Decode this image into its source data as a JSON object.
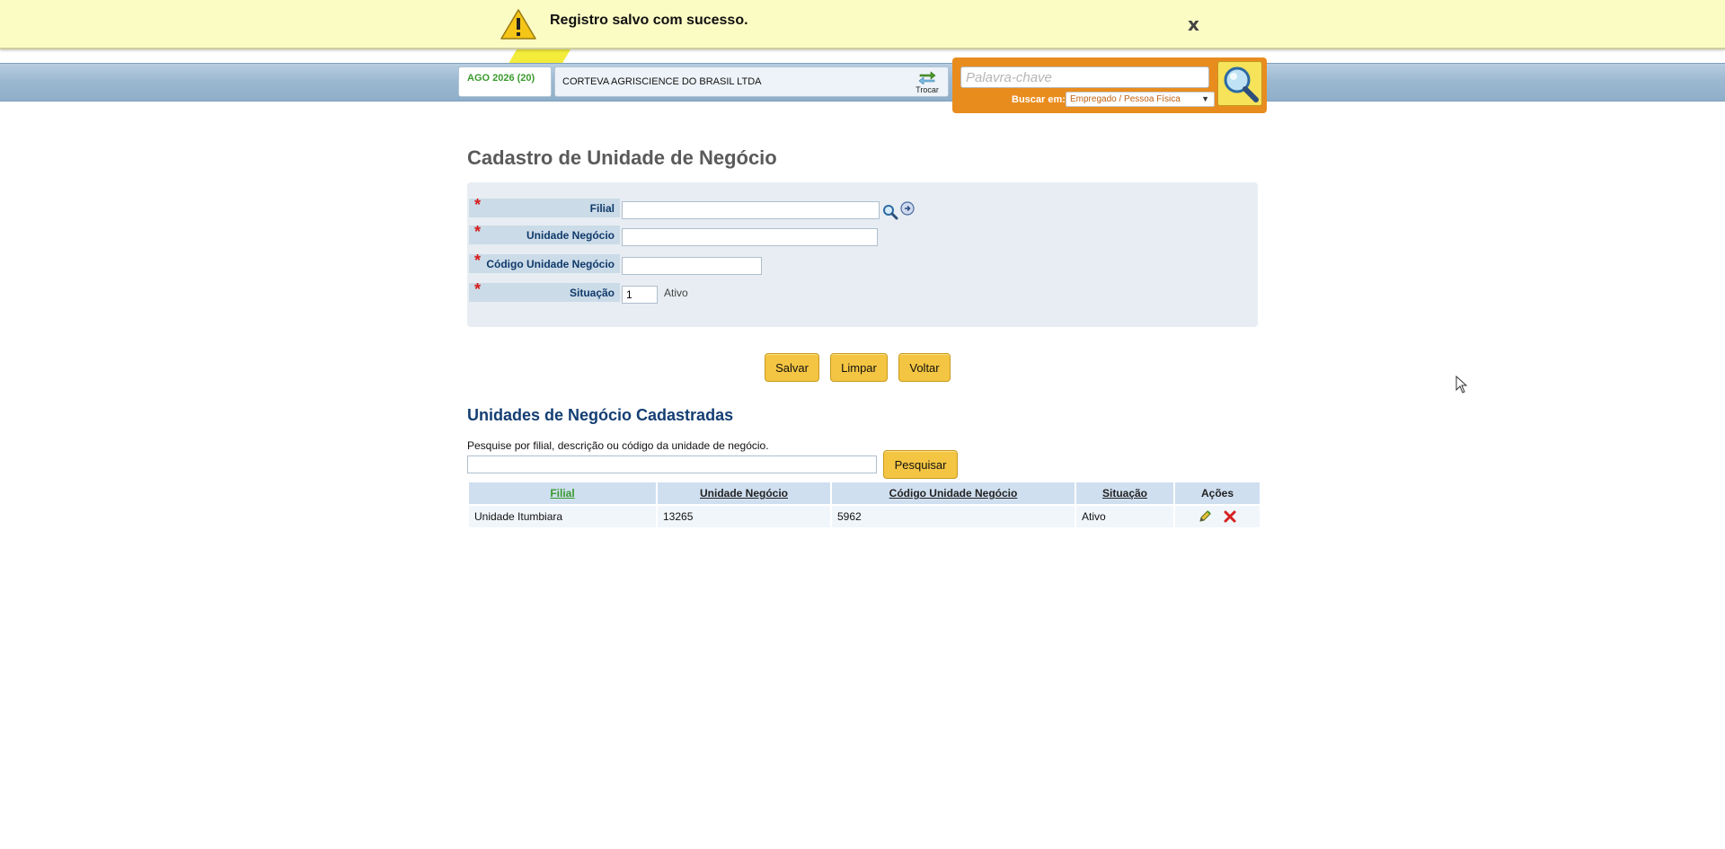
{
  "header": {
    "period": "AGO 2026 (20)",
    "company": "CORTEVA AGRISCIENCE DO BRASIL LTDA",
    "switch_label": "Trocar",
    "search": {
      "placeholder": "Palavra-chave",
      "search_in_label": "Buscar em:",
      "search_in_value": "Empregado / Pessoa Física"
    }
  },
  "notification": {
    "message": "Registro salvo com sucesso.",
    "close_label": "x"
  },
  "page": {
    "title": "Cadastro de Unidade de Negócio",
    "form": {
      "required_marker": "*",
      "fields": {
        "filial": {
          "label": "Filial",
          "value": ""
        },
        "unidade": {
          "label": "Unidade Negócio",
          "value": ""
        },
        "codigo": {
          "label": "Código Unidade Negócio",
          "value": ""
        },
        "situacao": {
          "label": "Situação",
          "value": "1",
          "status_text": "Ativo"
        }
      }
    },
    "buttons": {
      "save": "Salvar",
      "clear": "Limpar",
      "back": "Voltar"
    },
    "list": {
      "title": "Unidades de Negócio Cadastradas",
      "search_hint": "Pesquise por filial, descrição ou código da unidade de negócio.",
      "search_value": "",
      "search_button": "Pesquisar",
      "columns": [
        "Filial",
        "Unidade Negócio",
        "Código Unidade Negócio",
        "Situação",
        "Ações"
      ],
      "rows": [
        {
          "filial": "Unidade Itumbiara",
          "unidade": "13265",
          "codigo": "5962",
          "situacao": "Ativo"
        }
      ]
    }
  },
  "colors": {
    "accent_orange": "#e98c1e",
    "button_yellow": "#f4c542",
    "title_blue": "#143e73",
    "required_red": "#d61a1a",
    "notification_bg": "#fbfbc4"
  }
}
